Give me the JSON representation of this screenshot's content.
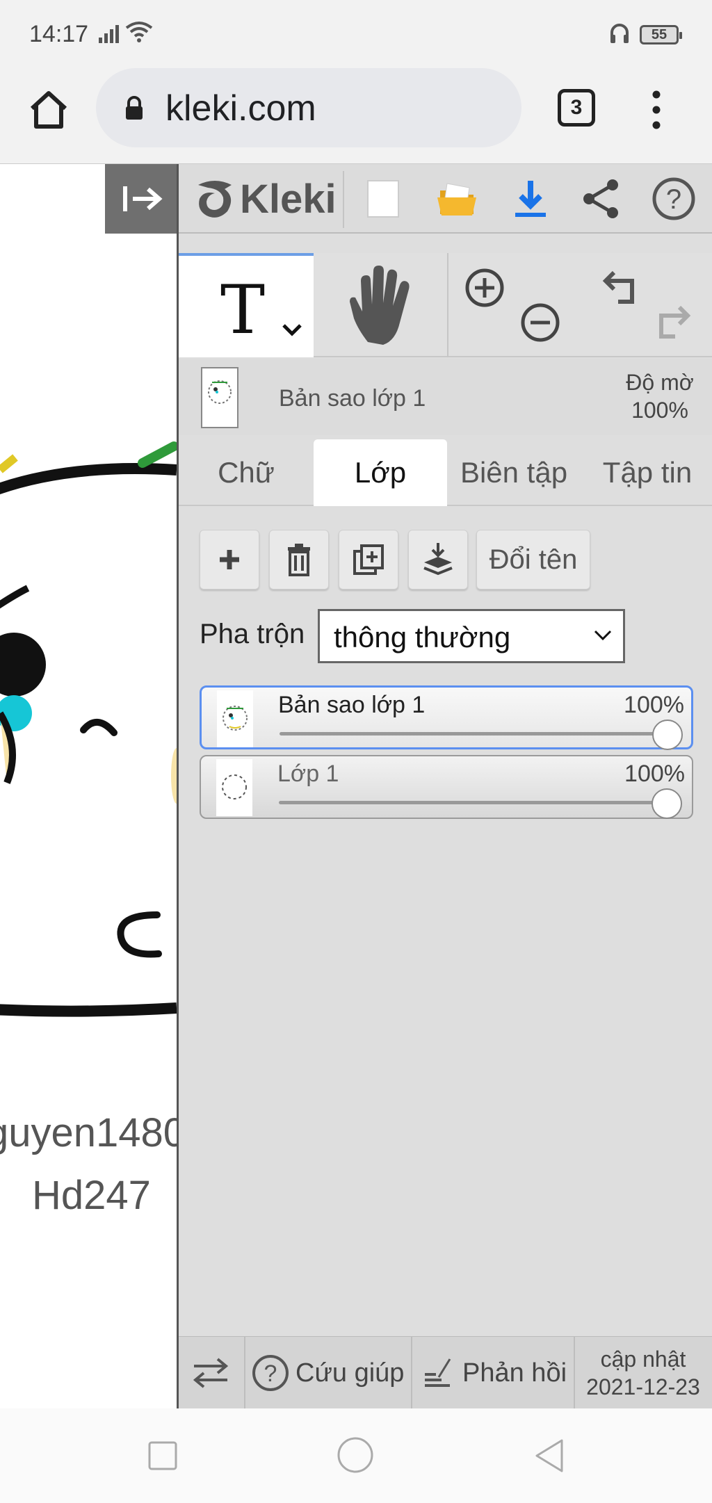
{
  "status_bar": {
    "time": "14:17",
    "battery": "55"
  },
  "browser": {
    "url": "kleki.com",
    "tab_count": "3"
  },
  "canvas": {
    "text_line1": "guyen1480",
    "text_line2": "Hd247"
  },
  "app": {
    "logo": "Kleki",
    "current_layer": {
      "name": "Bản sao lớp 1",
      "opacity_label": "Độ mờ",
      "opacity_value": "100%"
    },
    "tabs": [
      {
        "label": "Chữ",
        "active": false
      },
      {
        "label": "Lớp",
        "active": true
      },
      {
        "label": "Biên tập",
        "active": false
      },
      {
        "label": "Tập tin",
        "active": false
      }
    ],
    "actions": {
      "rename": "Đổi tên"
    },
    "blend": {
      "label": "Pha trộn",
      "value": "thông thường"
    },
    "layers": [
      {
        "name": "Bản sao lớp 1",
        "opacity": "100%",
        "opacity_fraction": 1.0,
        "selected": true
      },
      {
        "name": "Lớp 1",
        "opacity": "100%",
        "opacity_fraction": 1.0,
        "selected": false
      }
    ],
    "footer": {
      "help": "Cứu giúp",
      "feedback": "Phản hồi",
      "update_label": "cập nhật",
      "update_date": "2021-12-23"
    }
  },
  "colors": {
    "accent_blue": "#1a73e8",
    "tab_underline": "#6c9ee6",
    "folder_yellow": "#f5b82e",
    "panel_bg": "#dedede"
  }
}
